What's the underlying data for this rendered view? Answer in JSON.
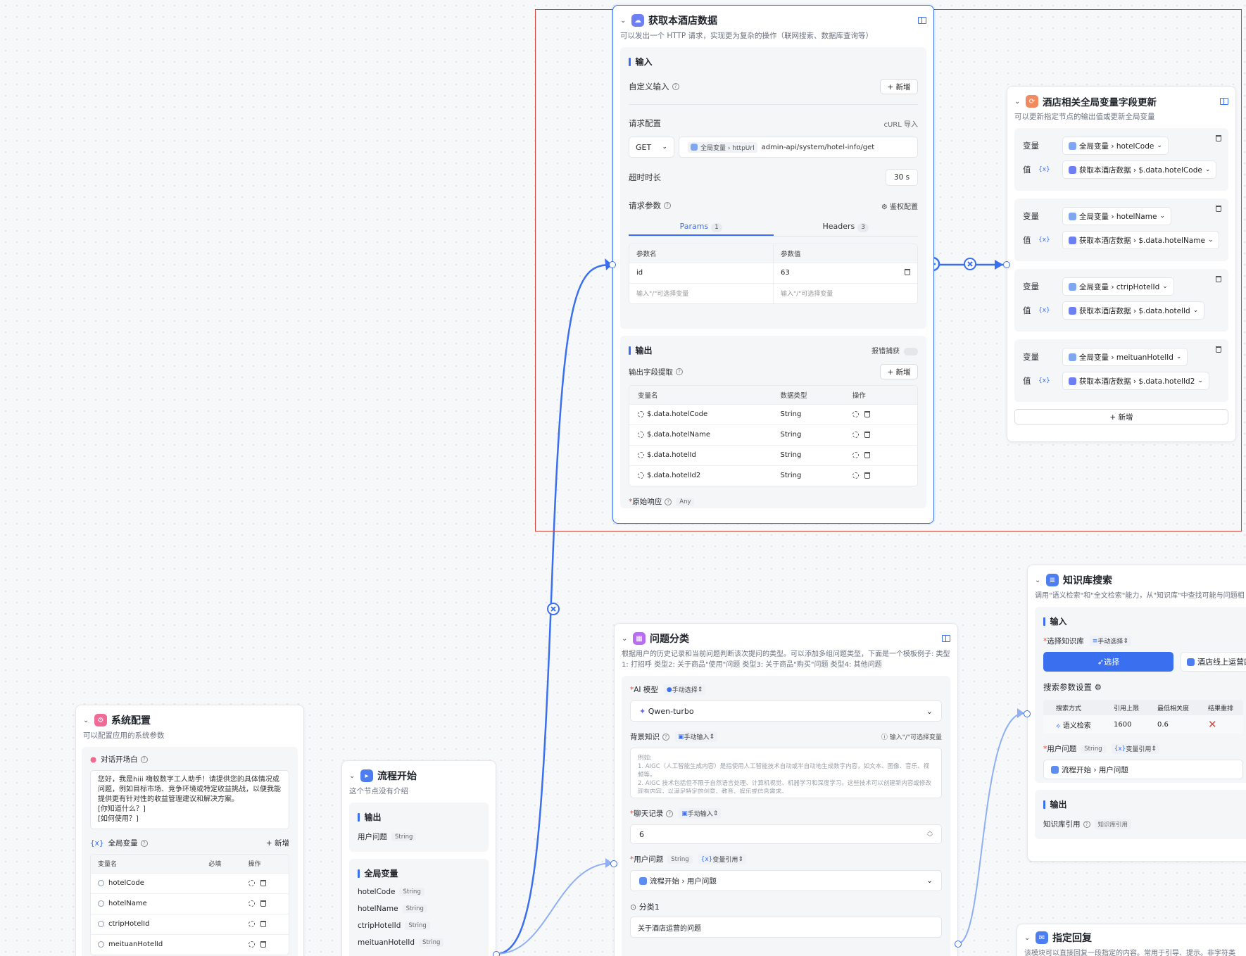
{
  "colors": {
    "accent": "#3a6ff0",
    "selection": "#d9413a",
    "danger": "#e0463e"
  },
  "hotel_node": {
    "title": "获取本酒店数据",
    "desc": "可以发出一个 HTTP 请求，实现更为复杂的操作（联网搜索、数据库查询等）",
    "input_section": "输入",
    "custom_input": "自定义输入",
    "add": "+ 新增",
    "request_config": "请求配置",
    "curl_import": "cURL 导入",
    "method": "GET",
    "url_var": "全局变量 › httpUrl",
    "url_path": "admin-api/system/hotel-info/get",
    "timeout_label": "超时时长",
    "timeout_value": "30 s",
    "params_label": "请求参数",
    "auth_config": "鉴权配置",
    "tab_params": "Params",
    "tab_params_count": "1",
    "tab_headers": "Headers",
    "tab_headers_count": "3",
    "col_param_name": "参数名",
    "col_param_value": "参数值",
    "param_name": "id",
    "param_value": "63",
    "param_placeholder": "输入\"/\"可选择变量",
    "output_section": "输出",
    "error_catch": "报错捕获",
    "output_extract": "输出字段提取",
    "col_var_name": "变量名",
    "col_data_type": "数据类型",
    "col_ops": "操作",
    "outputs": [
      {
        "name": "$.data.hotelCode",
        "type": "String"
      },
      {
        "name": "$.data.hotelName",
        "type": "String"
      },
      {
        "name": "$.data.hotelId",
        "type": "String"
      },
      {
        "name": "$.data.hotelId2",
        "type": "String"
      }
    ],
    "raw_response": "原始响应",
    "raw_response_type": "Any"
  },
  "update_node": {
    "title": "酒店相关全局变量字段更新",
    "desc": "可以更新指定节点的输出值或更新全局变量",
    "var_label": "变量",
    "value_label": "值",
    "rows": [
      {
        "var": "全局变量 › hotelCode",
        "value": "获取本酒店数据 › $.data.hotelCode"
      },
      {
        "var": "全局变量 › hotelName",
        "value": "获取本酒店数据 › $.data.hotelName"
      },
      {
        "var": "全局变量 › ctripHotelId",
        "value": "获取本酒店数据 › $.data.hotelId"
      },
      {
        "var": "全局变量 › meituanHotelId",
        "value": "获取本酒店数据 › $.data.hotelId2"
      }
    ],
    "add": "+ 新增"
  },
  "classify_node": {
    "title": "问题分类",
    "desc": "根据用户的历史记录和当前问题判断该次提问的类型。可以添加多组问题类型，下面是一个模板例子: 类型1: 打招呼 类型2: 关于商品\"使用\"问题 类型3: 关于商品\"购买\"问题 类型4: 其他问题",
    "ai_model_label": "AI 模型",
    "manual_select": "手动选择",
    "model": "Qwen-turbo",
    "background_label": "背景知识",
    "manual_input": "手动输入",
    "var_hint": "输入\"/\"可选择变量",
    "background_text": "例如:\n1. AIGC（人工智能生成内容）是指使用人工智能技术自动或半自动地生成数字内容，如文本、图像、音乐、视频等。\n2. AIGC 技术包括但不限于自然语言处理、计算机视觉、机器学习和深度学习。这些技术可以创建新内容或修改现有内容，以满足特定的创意、教育、娱乐或信息需求。",
    "history_label": "聊天记录",
    "history_value": "6",
    "question_label": "用户问题",
    "question_type": "String",
    "var_ref": "变量引用",
    "question_value": "流程开始 › 用户问题",
    "class1_label": "分类1",
    "class1_value": "关于酒店运营的问题"
  },
  "kb_node": {
    "title": "知识库搜索",
    "desc": "调用\"语义检索\"和\"全文检索\"能力，从\"知识库\"中查找可能与问题相",
    "input_section": "输入",
    "select_kb_label": "选择知识库",
    "manual_select": "手动选择",
    "select_btn": "选择",
    "kb_chip": "酒店线上运营四",
    "search_params": "搜索参数设置",
    "col_method": "搜索方式",
    "col_limit": "引用上限",
    "col_relevance": "最低相关度",
    "col_rerank": "结果重排",
    "method": "语义检索",
    "limit": "1600",
    "relevance": "0.6",
    "question_label": "用户问题",
    "question_type": "String",
    "var_ref": "变量引用",
    "question_value": "流程开始 › 用户问题",
    "output_section": "输出",
    "kb_ref_label": "知识库引用",
    "kb_ref_type": "知识库引用"
  },
  "reply_node": {
    "title": "指定回复",
    "desc": "该模块可以直接回复一段指定的内容。常用于引导、提示。非字符类"
  },
  "system_node": {
    "title": "系统配置",
    "desc": "可以配置应用的系统参数",
    "opening_label": "对话开场白",
    "opening_text": "您好，我是hiii 嗨蚁数字工人助手！请提供您的具体情况或问题，例如目标市场、竞争环境或特定收益挑战，以便我能提供更有针对性的收益管理建议和解决方案。\n[你知道什么？]\n[如何使用？]",
    "global_vars_label": "全局变量",
    "add": "+ 新增",
    "col_var_name": "变量名",
    "col_required": "必填",
    "col_ops": "操作",
    "vars": [
      "hotelCode",
      "hotelName",
      "ctripHotelId",
      "meituanHotelId"
    ]
  },
  "start_node": {
    "title": "流程开始",
    "desc": "这个节点没有介绍",
    "output_section": "输出",
    "user_question": "用户问题",
    "type": "String",
    "global_section": "全局变量",
    "vars": [
      "hotelCode",
      "hotelName",
      "ctripHotelId",
      "meituanHotelId"
    ]
  }
}
